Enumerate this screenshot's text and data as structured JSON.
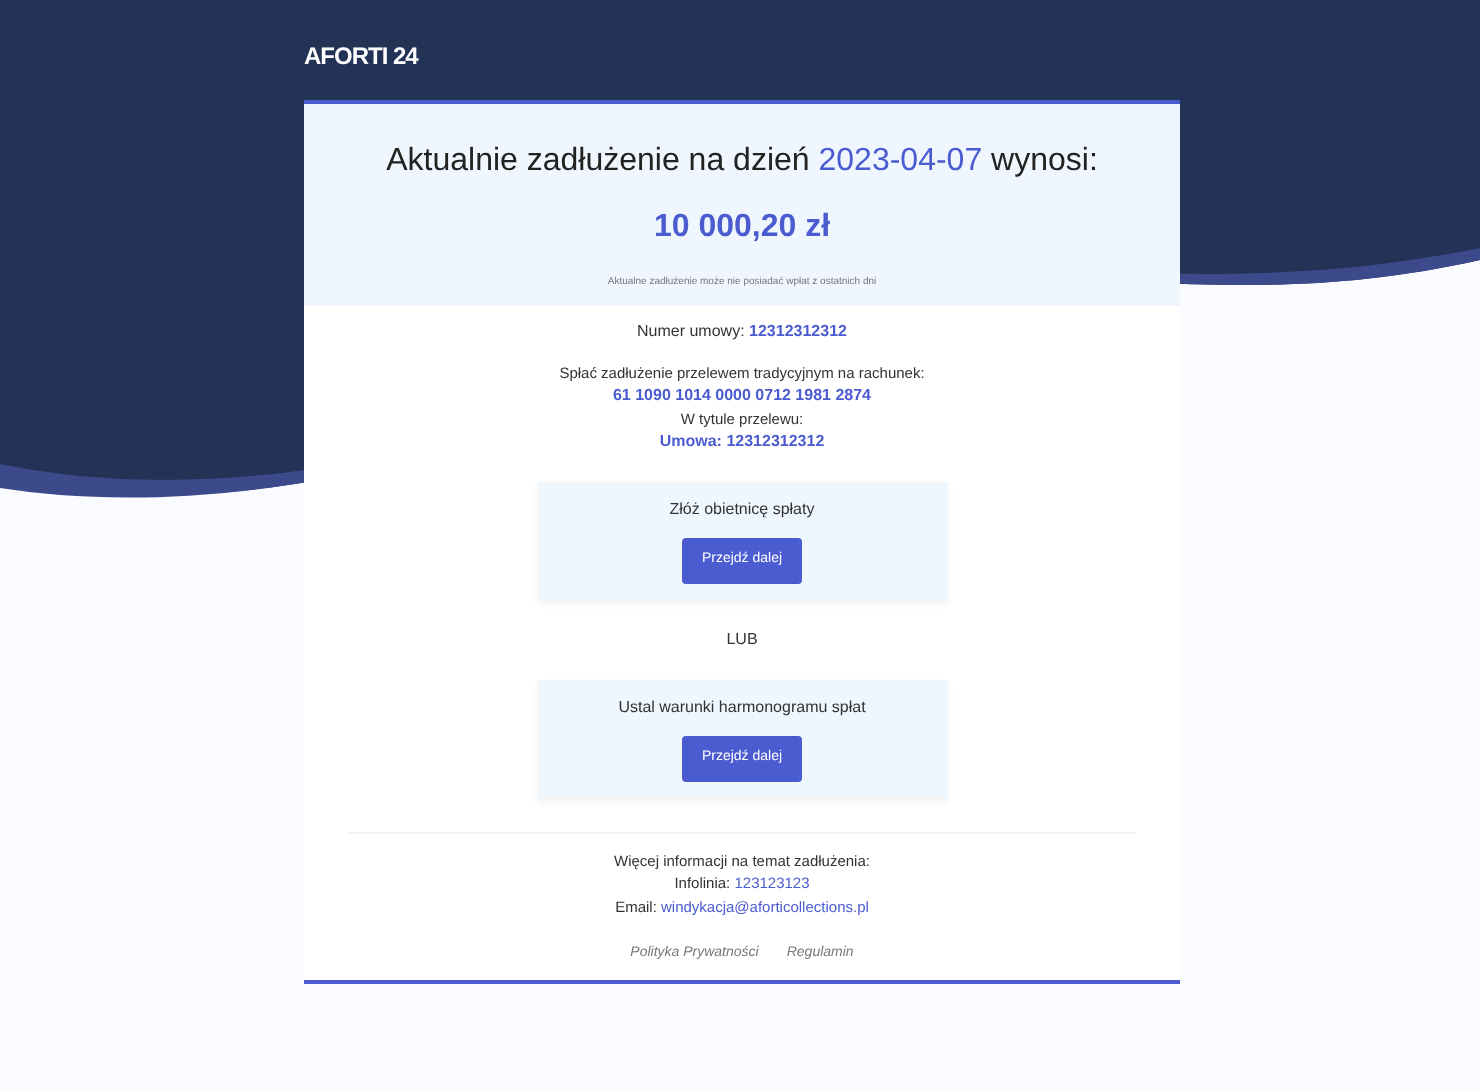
{
  "logo": "AFORTI 24",
  "header": {
    "title_before": "Aktualnie zadłużenie na dzień",
    "date": "2023-04-07",
    "title_after": "wynosi:",
    "amount": "10 000,20 zł",
    "note": "Aktualne zadłużenie może nie posiadać wpłat z ostatnich dni"
  },
  "contract": {
    "label": "Numer umowy:",
    "value": "12312312312"
  },
  "transfer": {
    "label": "Spłać zadłużenie przelewem tradycyjnym na rachunek:",
    "account": "61 1090 1014 0000 0712 1981 2874",
    "title_label": "W tytule przelewu:",
    "title_value": "Umowa: 12312312312"
  },
  "options": [
    {
      "title": "Złóż obietnicę spłaty",
      "button": "Przejdź dalej"
    },
    {
      "title": "Ustal warunki harmonogramu spłat",
      "button": "Przejdź dalej"
    }
  ],
  "separator": "LUB",
  "contact": {
    "heading": "Więcej informacji na temat zadłużenia:",
    "phone_label": "Infolinia:",
    "phone": "123123123",
    "email_label": "Email:",
    "email": "windykacja@aforticollections.pl"
  },
  "footer_links": [
    "Polityka Prywatności",
    "Regulamin"
  ]
}
